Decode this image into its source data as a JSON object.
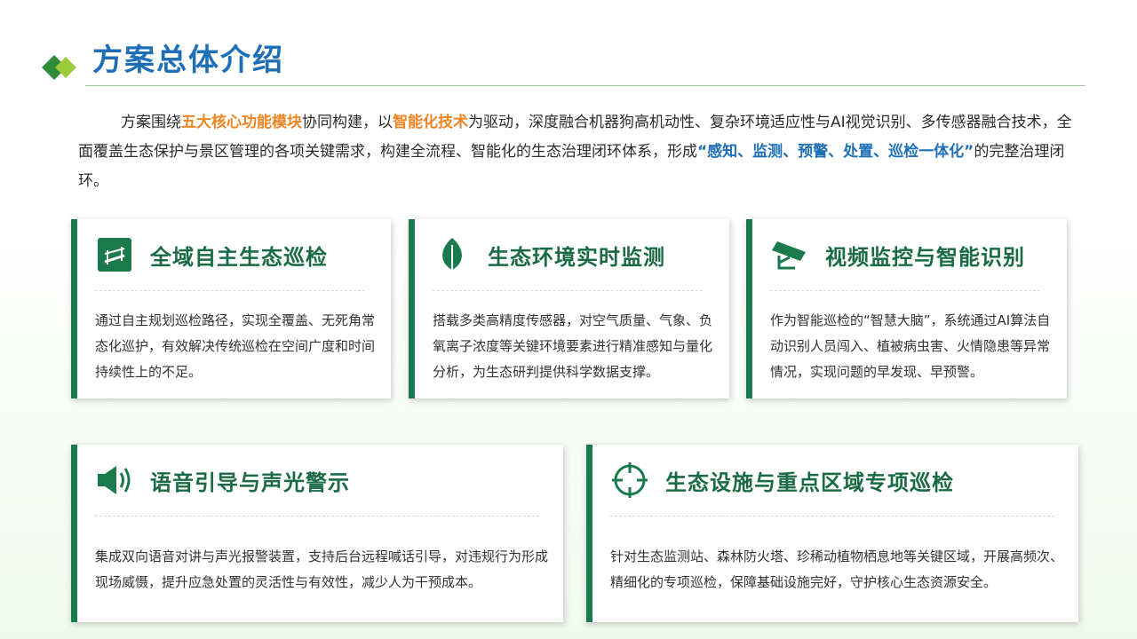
{
  "header": {
    "title": "方案总体介绍"
  },
  "intro": {
    "p1": "方案围绕",
    "h1": "五大核心功能模块",
    "p2": "协同构建，以",
    "h2": "智能化技术",
    "p3": "为驱动，深度融合机器狗高机动性、复杂环境适应性与AI视觉识别、多传感器融合技术，全面覆盖生态保护与景区管理的各项关键需求，构建全流程、智能化的生态治理闭环体系，形成",
    "h3": "“感知、监测、预警、处置、巡检一体化”",
    "p4": "的完整治理闭环。"
  },
  "cards": [
    {
      "icon": "patrol-road-icon",
      "title": "全域自主生态巡检",
      "body": "通过自主规划巡检路径，实现全覆盖、无死角常态化巡护，有效解决传统巡检在空间广度和时间持续性上的不足。"
    },
    {
      "icon": "leaf-icon",
      "title": "生态环境实时监测",
      "body": "搭载多类高精度传感器，对空气质量、气象、负氧离子浓度等关键环境要素进行精准感知与量化分析，为生态研判提供科学数据支撑。"
    },
    {
      "icon": "camera-icon",
      "title": "视频监控与智能识别",
      "body": "作为智能巡检的“智慧大脑”，系统通过AI算法自动识别人员闯入、植被病虫害、火情隐患等异常情况，实现问题的早发现、早预警。"
    },
    {
      "icon": "speaker-icon",
      "title": "语音引导与声光警示",
      "body": "集成双向语音对讲与声光报警装置，支持后台远程喊话引导，对违规行为形成现场威慑，提升应急处置的灵活性与有效性，减少人为干预成本。"
    },
    {
      "icon": "crosshair-icon",
      "title": "生态设施与重点区域专项巡检",
      "body": "针对生态监测站、森林防火塔、珍稀动植物栖息地等关键区域，开展高频次、精细化的专项巡检，保障基础设施完好，守护核心生态资源安全。"
    }
  ],
  "colors": {
    "title_blue": "#1f6fb8",
    "accent_orange": "#ef8424",
    "card_green": "#1a7a4c"
  }
}
